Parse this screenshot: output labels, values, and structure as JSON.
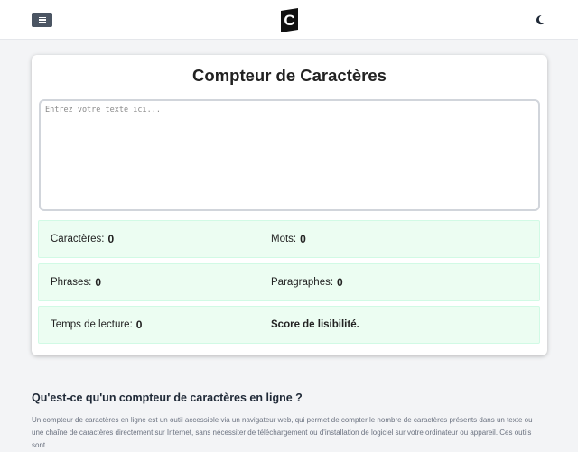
{
  "header": {
    "menu_icon": "hamburger-icon",
    "logo_letter": "C",
    "logo_color": "#111111",
    "theme_icon": "moon-icon"
  },
  "counter": {
    "title": "Compteur de Caractères",
    "textarea_placeholder": "Entrez votre texte ici...",
    "textarea_value": "",
    "stats": {
      "characters_label": "Caractères:",
      "characters_value": "0",
      "words_label": "Mots:",
      "words_value": "0",
      "sentences_label": "Phrases:",
      "sentences_value": "0",
      "paragraphs_label": "Paragraphes:",
      "paragraphs_value": "0",
      "reading_time_label": "Temps de lecture:",
      "reading_time_value": "0",
      "readability_label": "Score de lisibilité."
    },
    "stat_bg_color": "#ecfdf2"
  },
  "article": {
    "heading": "Qu'est-ce qu'un compteur de caractères en ligne ?",
    "paragraph": "Un compteur de caractères en ligne est un outil accessible via un navigateur web, qui permet de compter le nombre de caractères présents dans un texte ou une chaîne de caractères directement sur Internet, sans nécessiter de téléchargement ou d'installation de logiciel sur votre ordinateur ou appareil. Ces outils sont"
  }
}
